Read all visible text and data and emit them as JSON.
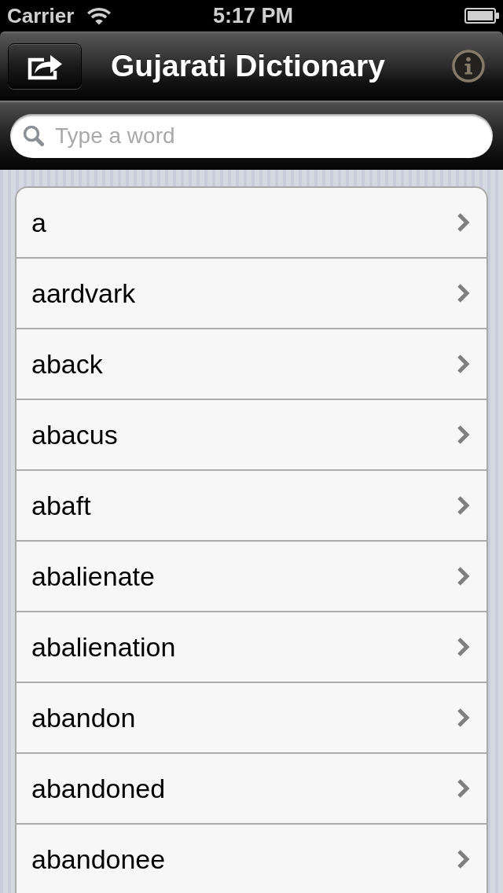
{
  "status_bar": {
    "carrier": "Carrier",
    "time": "5:17 PM"
  },
  "nav_bar": {
    "title": "Gujarati Dictionary"
  },
  "search": {
    "placeholder": "Type a word"
  },
  "words": [
    "a",
    "aardvark",
    "aback",
    "abacus",
    "abaft",
    "abalienate",
    "abalienation",
    "abandon",
    "abandoned",
    "abandonee"
  ]
}
